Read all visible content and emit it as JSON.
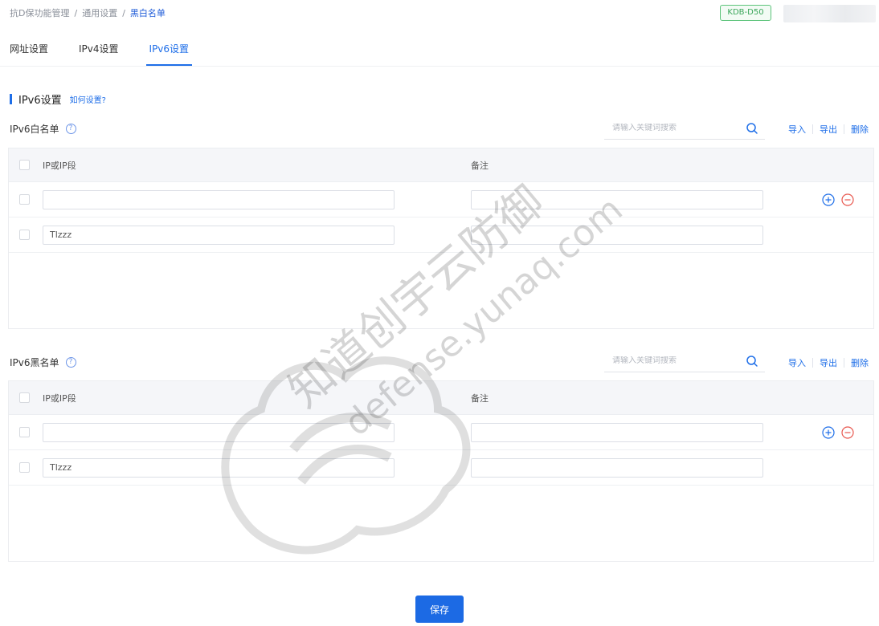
{
  "breadcrumb": {
    "item1": "抗D保功能管理",
    "sep1": "/",
    "item2": "通用设置",
    "sep2": "/",
    "current": "黑白名单"
  },
  "badge": {
    "label": "KDB-D50"
  },
  "tabs": [
    {
      "label": "网址设置"
    },
    {
      "label": "IPv4设置"
    },
    {
      "label": "IPv6设置"
    }
  ],
  "section": {
    "title": "IPv6设置",
    "help_link": "如何设置?"
  },
  "whitelist": {
    "title": "IPv6白名单",
    "search_placeholder": "请输入关键词搜索",
    "actions": {
      "import": "导入",
      "export": "导出",
      "delete": "删除"
    },
    "columns": {
      "ip": "IP或IP段",
      "note": "备注"
    },
    "rows": [
      {
        "ip": "",
        "note": ""
      },
      {
        "ip": "Tlzzz",
        "note": ""
      }
    ]
  },
  "blacklist": {
    "title": "IPv6黑名单",
    "search_placeholder": "请输入关键词搜索",
    "actions": {
      "import": "导入",
      "export": "导出",
      "delete": "删除"
    },
    "columns": {
      "ip": "IP或IP段",
      "note": "备注"
    },
    "rows": [
      {
        "ip": "",
        "note": ""
      },
      {
        "ip": "Tlzzz",
        "note": ""
      }
    ]
  },
  "save_label": "保存",
  "watermark": {
    "line1": "知道创宇云防御",
    "line2": "defense.yunaq.com"
  },
  "colors": {
    "primary": "#1e6ee8",
    "danger": "#e8584f",
    "badge_green": "#3aa65a"
  }
}
